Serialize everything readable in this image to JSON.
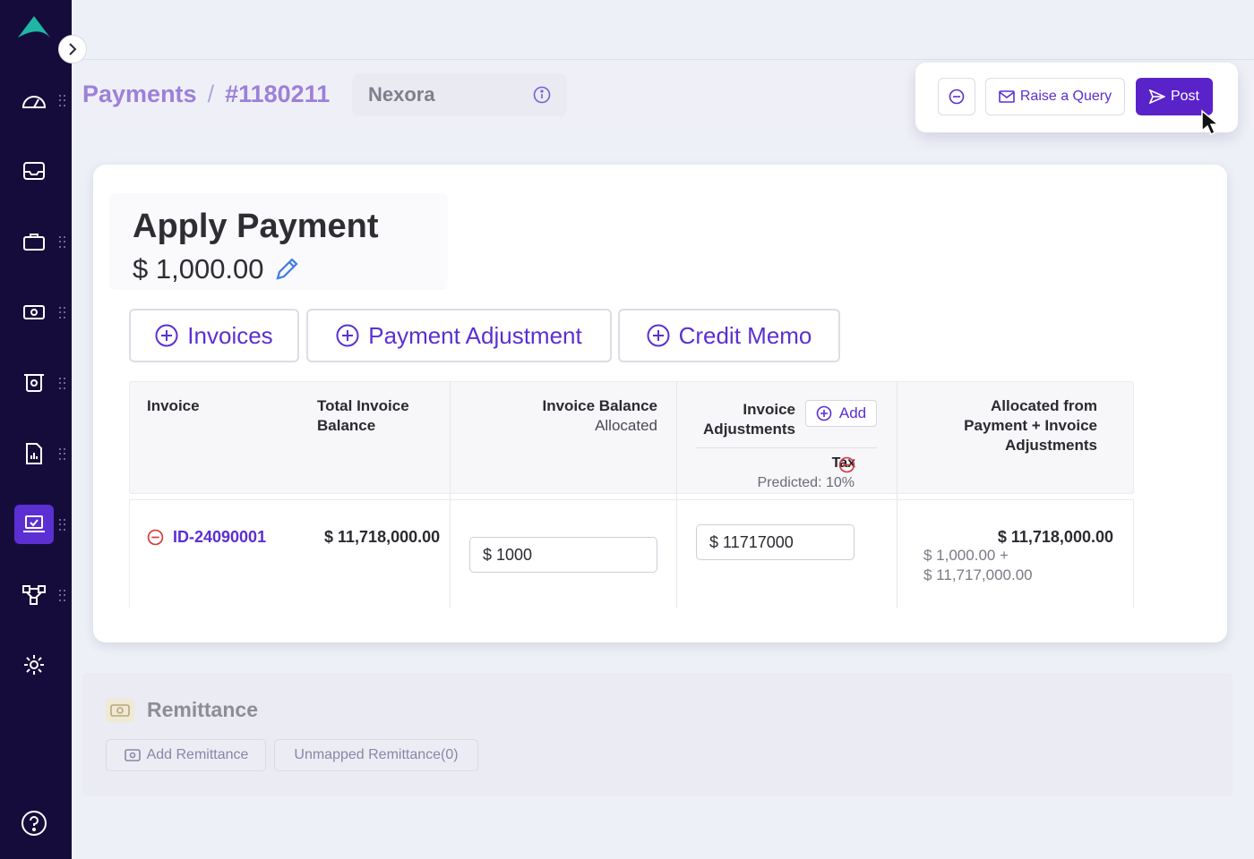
{
  "breadcrumb": {
    "section": "Payments",
    "separator": "/",
    "record": "#1180211"
  },
  "vendor": {
    "name": "Nexora"
  },
  "actions": {
    "query_label": "Raise a Query",
    "post_label": "Post"
  },
  "apply": {
    "title": "Apply Payment",
    "amount": "$ 1,000.00"
  },
  "tabs": [
    {
      "label": "Invoices"
    },
    {
      "label": "Payment Adjustment"
    },
    {
      "label": "Credit Memo"
    }
  ],
  "table": {
    "headers": {
      "invoice": "Invoice",
      "total_balance_1": "Total Invoice",
      "total_balance_2": "Balance",
      "balance_allocated_1": "Invoice Balance",
      "balance_allocated_2": "Allocated",
      "adjustments_1": "Invoice",
      "adjustments_2": "Adjustments",
      "add_label": "Add",
      "tax_label": "Tax",
      "tax_predicted": "Predicted: 10%",
      "allocated_1": "Allocated from",
      "allocated_2": "Payment + Invoice",
      "allocated_3": "Adjustments"
    },
    "row": {
      "invoice_id": "ID-24090001",
      "total_balance": "$  11,718,000.00",
      "balance_allocated": "$ 1000",
      "adjustment_value": "$ 11717000",
      "allocated_total": "$  11,718,000.00",
      "allocated_line1": "$  1,000.00 +",
      "allocated_line2": "$  11,717,000.00"
    }
  },
  "remittance": {
    "title": "Remittance",
    "add_label": "Add Remittance",
    "unmapped_label": "Unmapped Remittance(0)"
  },
  "colors": {
    "sidebar": "#160c3b",
    "accent": "#5b2fd2",
    "danger": "#d63b3b",
    "logo": "#1fb6a6"
  }
}
